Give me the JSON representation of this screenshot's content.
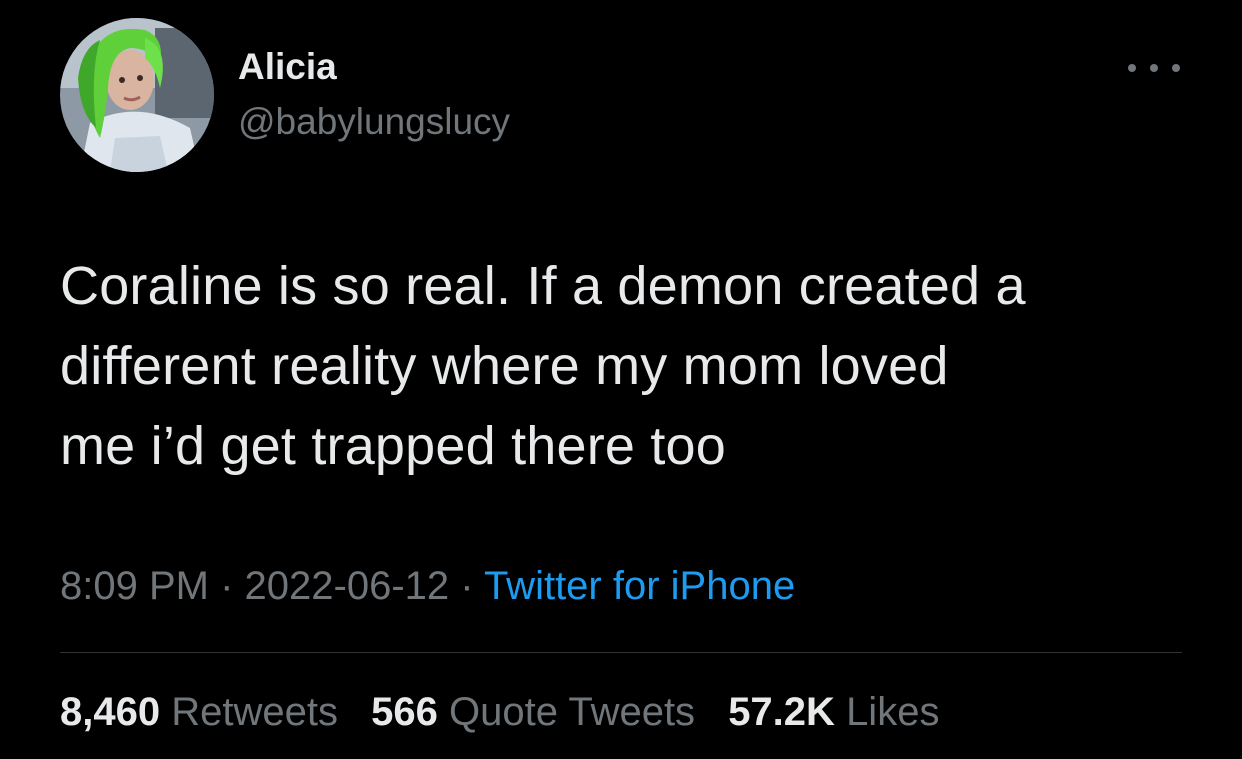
{
  "author": {
    "display_name": "Alicia",
    "handle": "@babylungslucy"
  },
  "tweet": {
    "lines": [
      "Coraline is so real. If a demon created a",
      "different reality where my mom loved",
      "me i’d get trapped there too"
    ],
    "time": "8:09 PM",
    "separator": " · ",
    "date": "2022-06-12",
    "source": "Twitter for iPhone"
  },
  "stats": {
    "retweets_count": "8,460",
    "retweets_label": "Retweets",
    "quotes_count": "566",
    "quotes_label": "Quote Tweets",
    "likes_count": "57.2K",
    "likes_label": "Likes"
  },
  "icons": {
    "more": "more-horizontal-icon",
    "avatar": "profile-photo"
  },
  "colors": {
    "background": "#000000",
    "primary_text": "#e7e9ea",
    "secondary_text": "#71767b",
    "link": "#1d9bf0",
    "divider": "#2f3336"
  }
}
